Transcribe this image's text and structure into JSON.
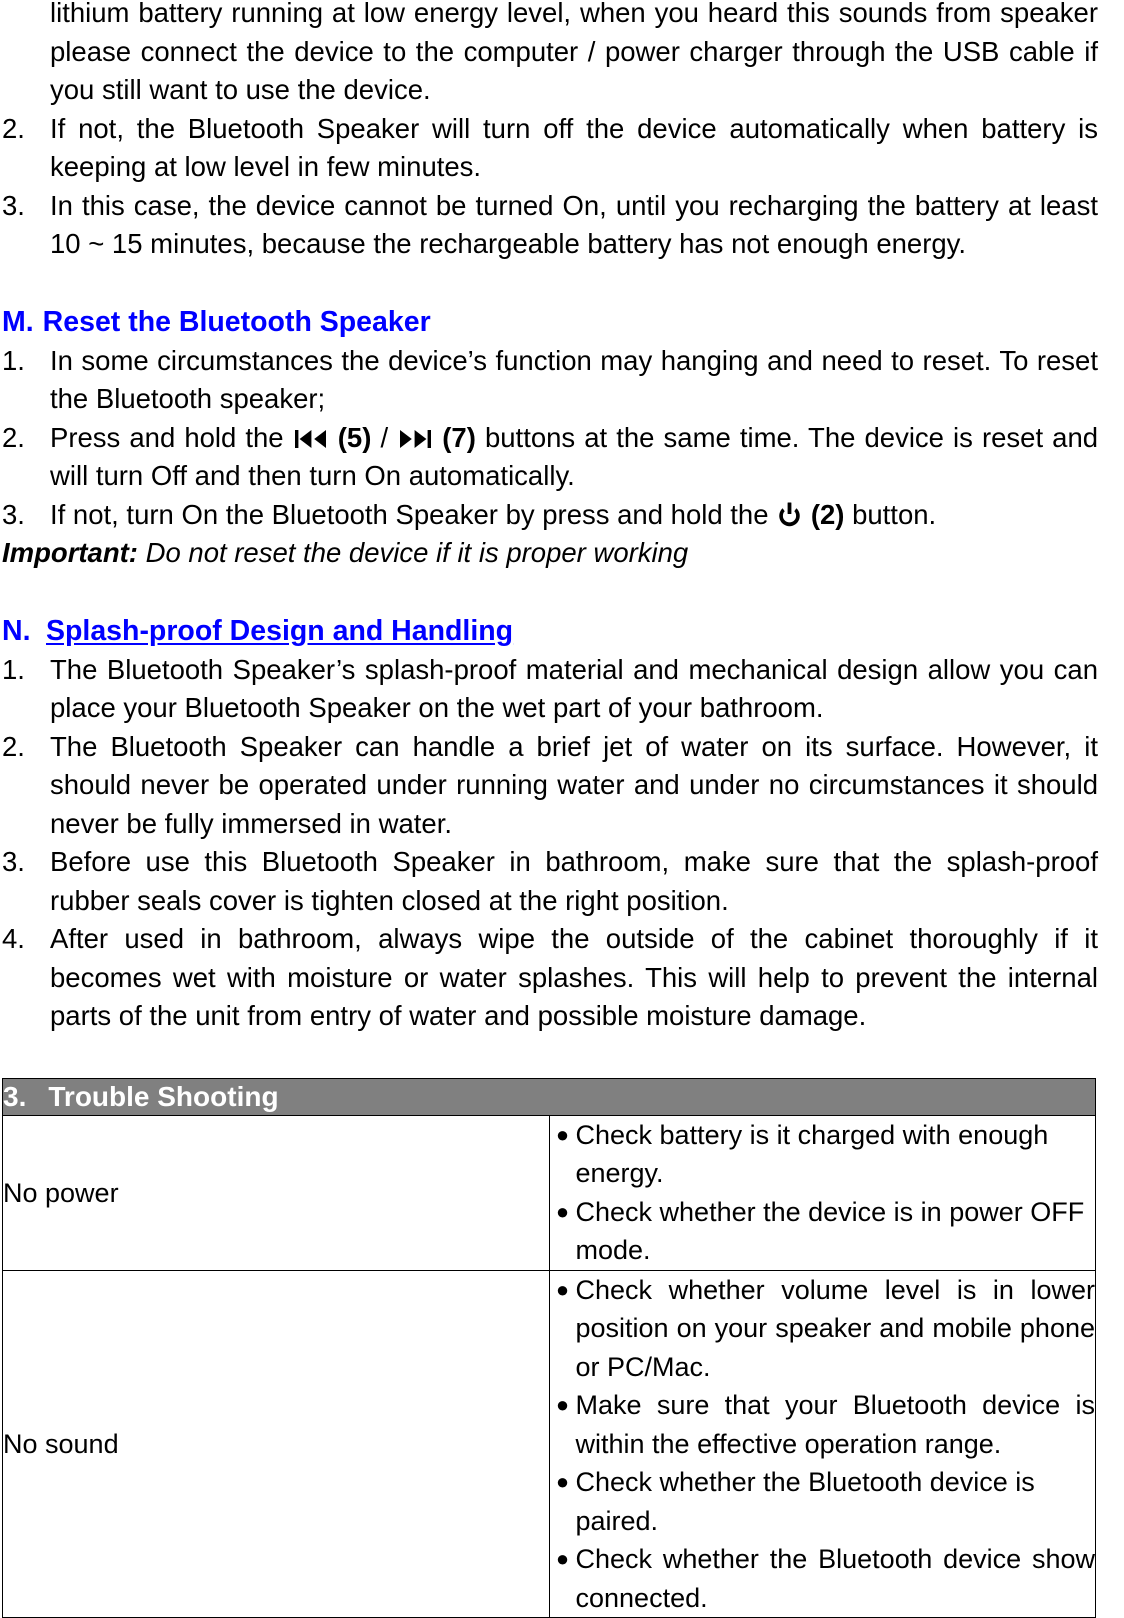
{
  "page": {
    "continued_paragraph": "lithium battery running at low energy level, when you heard this sounds from speaker please connect the device to the computer / power charger through the USB cable if you still want to use the device.",
    "battery_items": [
      {
        "number": "2.",
        "text": "If not, the Bluetooth Speaker will turn off the device automatically when battery is keeping at low level in few minutes."
      },
      {
        "number": "3.",
        "text": "In this case, the device cannot be turned On, until you recharging the battery at least 10 ~ 15 minutes, because the rechargeable battery has not enough energy."
      }
    ]
  },
  "section_m": {
    "letter": "M.",
    "title": "Reset the Bluetooth Speaker",
    "color": "#0000FF",
    "item1": {
      "number": "1.",
      "text": "In some circumstances the device’s function may hanging and need to reset. To reset the Bluetooth speaker;"
    },
    "item2": {
      "number": "2.",
      "before": "Press and hold the",
      "prev_icon": "previous-track-icon",
      "prev_label": "(5)",
      "separator": "/",
      "next_icon": "next-track-icon",
      "next_label": "(7)",
      "after": "buttons at the same time. The device is reset and will turn Off and then turn On automatically."
    },
    "item3": {
      "number": "3.",
      "before": "If not, turn On the Bluetooth Speaker by press and hold the",
      "power_icon": "power-icon",
      "power_label": "(2)",
      "after": "button."
    },
    "important": {
      "lead": "Important:",
      "text": " Do not reset the device if it is proper working"
    }
  },
  "section_n": {
    "letter": "N.",
    "title": "Splash-proof Design and Handling",
    "color": "#0000FF",
    "items": [
      {
        "number": "1.",
        "text": "The Bluetooth Speaker’s splash-proof material and mechanical design allow you can place your Bluetooth Speaker on the wet part of your bathroom."
      },
      {
        "number": "2.",
        "text": "The Bluetooth Speaker can handle a brief jet of water on its surface. However, it should never be operated under running water and under no circumstances it should never be fully immersed in water."
      },
      {
        "number": "3.",
        "text": "Before use this Bluetooth Speaker in bathroom, make sure that the splash-proof rubber seals cover is tighten closed at the right position."
      },
      {
        "number": "4.",
        "text": "After used in bathroom, always wipe the outside of the cabinet thoroughly if it becomes wet with moisture or water splashes. This will help to prevent the internal parts of the unit from entry of water and possible moisture damage."
      }
    ]
  },
  "trouble_shooting": {
    "header_number": "3.",
    "header_title": "Trouble Shooting",
    "header_bg": "#808080",
    "header_color": "#FFFFFF",
    "bullet_glyph": "●",
    "rows": [
      {
        "label": "No power",
        "checks": [
          "Check battery is it charged with enough energy.",
          "Check whether the device is in power OFF mode."
        ]
      },
      {
        "label": "No sound",
        "checks": [
          "Check whether volume level is in lower position on your speaker and mobile phone or PC/Mac.",
          "Make sure that your Bluetooth device is within the effective operation range.",
          "Check whether the Bluetooth device is paired.",
          "Check whether the Bluetooth device show connected."
        ]
      }
    ]
  }
}
